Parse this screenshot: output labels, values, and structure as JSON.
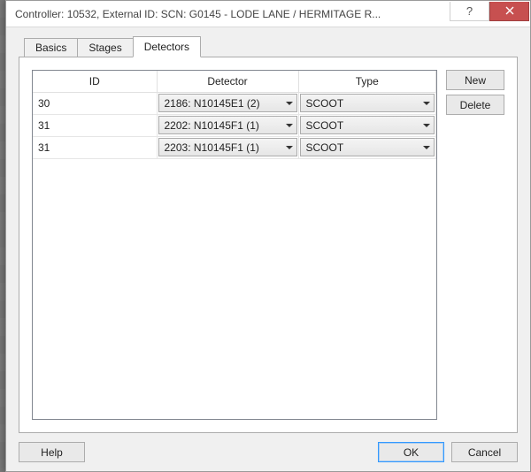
{
  "title": "Controller: 10532, External ID: SCN: G0145 - LODE LANE / HERMITAGE R...",
  "tabs": [
    {
      "label": "Basics",
      "active": false
    },
    {
      "label": "Stages",
      "active": false
    },
    {
      "label": "Detectors",
      "active": true
    }
  ],
  "columns": {
    "id": "ID",
    "detector": "Detector",
    "type": "Type"
  },
  "rows": [
    {
      "id": "30",
      "detector": "2186: N10145E1 (2)",
      "type": "SCOOT"
    },
    {
      "id": "31",
      "detector": "2202: N10145F1 (1)",
      "type": "SCOOT"
    },
    {
      "id": "31",
      "detector": "2203: N10145F1 (1)",
      "type": "SCOOT"
    }
  ],
  "side": {
    "new": "New",
    "delete": "Delete"
  },
  "bottom": {
    "help": "Help",
    "ok": "OK",
    "cancel": "Cancel"
  }
}
